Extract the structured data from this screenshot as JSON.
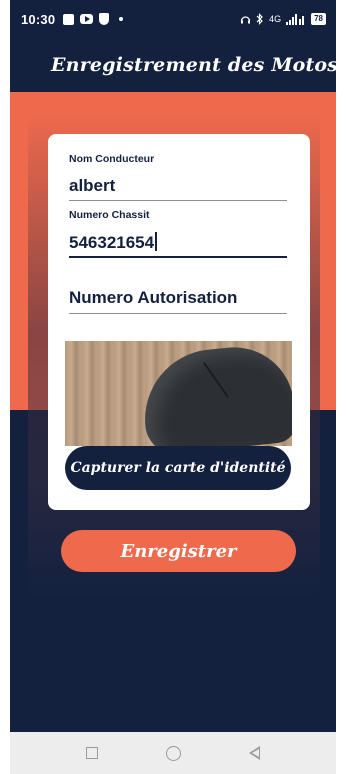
{
  "status_bar": {
    "time": "10:30",
    "network": "4G",
    "battery": "78",
    "icons": [
      "notification-square-icon",
      "youtube-icon",
      "shield-icon",
      "dot-icon",
      "headset-icon",
      "bluetooth-icon",
      "signal-icon",
      "battery-icon"
    ]
  },
  "app_bar": {
    "title": "Enregistrement des Motos",
    "menu_icon": "hamburger-menu-icon"
  },
  "form": {
    "driver_name": {
      "label": "Nom Conducteur",
      "value": "albert"
    },
    "chassis_number": {
      "label": "Numero Chassit",
      "value": "546321654"
    },
    "authorization_number": {
      "placeholder": "Numero Autorisation"
    }
  },
  "capture_button": {
    "label": "Capturer la carte d'identité"
  },
  "save_button": {
    "label": "Enregistrer"
  },
  "nav_bar": {
    "icons": [
      "recent-apps-icon",
      "home-icon",
      "back-icon"
    ]
  },
  "colors": {
    "navy": "#13213f",
    "orange": "#ef6a4d",
    "card": "#ffffff"
  }
}
